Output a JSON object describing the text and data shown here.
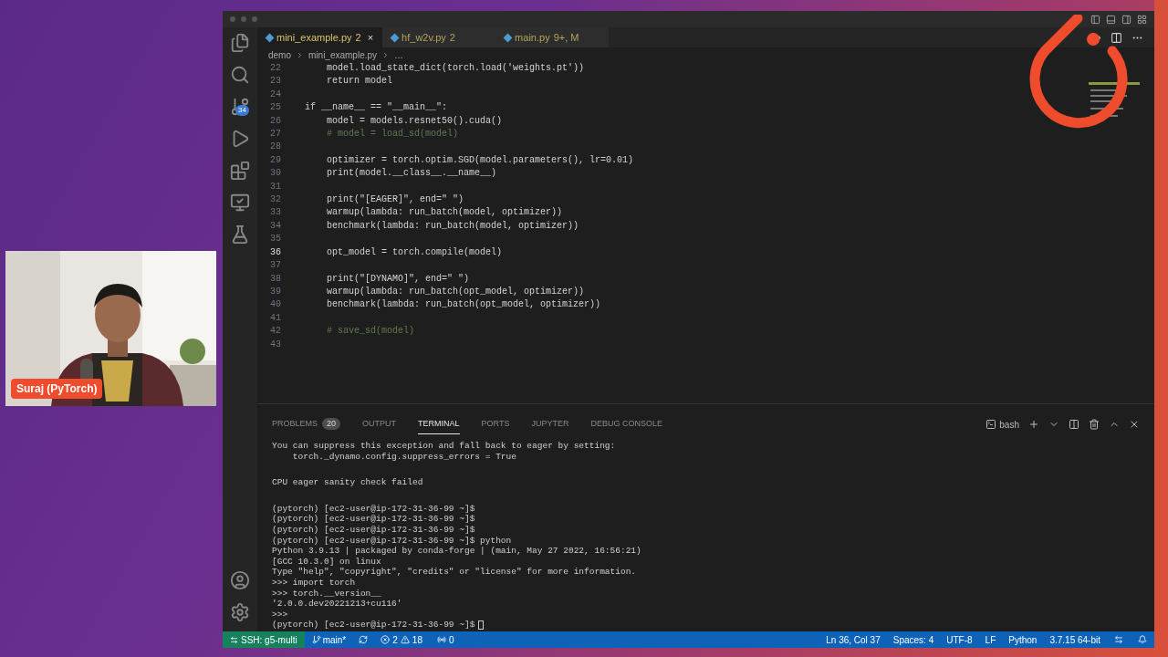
{
  "webcam": {
    "kind": "picture",
    "name_label": "Suraj (PyTorch)"
  },
  "editor_tabs": [
    {
      "label": "mini_example.py",
      "badge": "2",
      "selected": true,
      "close": "×"
    },
    {
      "label": "hf_w2v.py",
      "badge": "2",
      "selected": false
    },
    {
      "label": "main.py",
      "badge": "9+, M",
      "selected": false
    }
  ],
  "breadcrumb": [
    "demo",
    "mini_example.py",
    "…"
  ],
  "activity_bar": {
    "source_control_badge": "34"
  },
  "code_lines": [
    {
      "number": "22",
      "text": "    model.load_state_dict(torch.load('weights.pt'))",
      "kind": "code",
      "selected": false
    },
    {
      "number": "23",
      "text": "    return model",
      "kind": "code",
      "selected": false
    },
    {
      "number": "24",
      "selected": false
    },
    {
      "number": "25",
      "text": "if __name__ == \"__main__\":",
      "kind": "code",
      "selected": false
    },
    {
      "number": "26",
      "text": "    model = models.resnet50().cuda()",
      "kind": "code",
      "selected": false
    },
    {
      "number": "27",
      "text": "    # model = load_sd(model)",
      "kind": "comment",
      "selected": false
    },
    {
      "number": "28",
      "selected": false
    },
    {
      "number": "29",
      "text": "    optimizer = torch.optim.SGD(model.parameters(), lr=0.01)",
      "kind": "code",
      "selected": false
    },
    {
      "number": "30",
      "text": "    print(model.__class__.__name__)",
      "kind": "code",
      "selected": false
    },
    {
      "number": "31",
      "selected": false
    },
    {
      "number": "32",
      "text": "    print(\"[EAGER]\", end=\" \")",
      "kind": "code",
      "selected": false
    },
    {
      "number": "33",
      "text": "    warmup(lambda: run_batch(model, optimizer))",
      "kind": "code",
      "selected": false
    },
    {
      "number": "34",
      "text": "    benchmark(lambda: run_batch(model, optimizer))",
      "kind": "code",
      "selected": false
    },
    {
      "number": "35",
      "selected": false
    },
    {
      "number": "36",
      "text": "    opt_model = torch.compile(model)",
      "kind": "code",
      "selected": true
    },
    {
      "number": "37",
      "selected": false
    },
    {
      "number": "38",
      "text": "    print(\"[DYNAMO]\", end=\" \")",
      "kind": "code",
      "selected": false
    },
    {
      "number": "39",
      "text": "    warmup(lambda: run_batch(opt_model, optimizer))",
      "kind": "code",
      "selected": false
    },
    {
      "number": "40",
      "text": "    benchmark(lambda: run_batch(opt_model, optimizer))",
      "kind": "code",
      "selected": false
    },
    {
      "number": "41",
      "selected": false
    },
    {
      "number": "42",
      "text": "    # save_sd(model)",
      "kind": "comment",
      "selected": false
    },
    {
      "number": "43",
      "selected": false
    }
  ],
  "panel_tabs": [
    {
      "label": "PROBLEMS",
      "badge": "20",
      "selected": false
    },
    {
      "label": "OUTPUT",
      "selected": false
    },
    {
      "label": "TERMINAL",
      "selected": true
    },
    {
      "label": "PORTS",
      "selected": false
    },
    {
      "label": "JUPYTER",
      "selected": false
    },
    {
      "label": "DEBUG CONSOLE",
      "selected": false
    }
  ],
  "terminal_name": "bash",
  "terminal_blocks": [
    [
      "You can suppress this exception and fall back to eager by setting:",
      "    torch._dynamo.config.suppress_errors = True"
    ],
    [
      "CPU eager sanity check failed"
    ],
    [
      "(pytorch) [ec2-user@ip-172-31-36-99 ~]$",
      "(pytorch) [ec2-user@ip-172-31-36-99 ~]$",
      "(pytorch) [ec2-user@ip-172-31-36-99 ~]$",
      "(pytorch) [ec2-user@ip-172-31-36-99 ~]$ python",
      "Python 3.9.13 | packaged by conda-forge | (main, May 27 2022, 16:56:21)",
      "[GCC 10.3.0] on linux",
      "Type \"help\", \"copyright\", \"credits\" or \"license\" for more information.",
      ">>> import torch",
      ">>> torch.__version__",
      "'2.0.0.dev20221213+cu116'",
      ">>>",
      "(pytorch) [ec2-user@ip-172-31-36-99 ~]$"
    ]
  ],
  "status_bar": {
    "remote": "SSH: g5-multi",
    "branch": "main*",
    "errors": "2",
    "warnings": "18",
    "ports": "0",
    "right": [
      "Ln 36, Col 37",
      "Spaces: 4",
      "UTF-8",
      "LF",
      "Python",
      "3.7.15 64-bit"
    ]
  }
}
